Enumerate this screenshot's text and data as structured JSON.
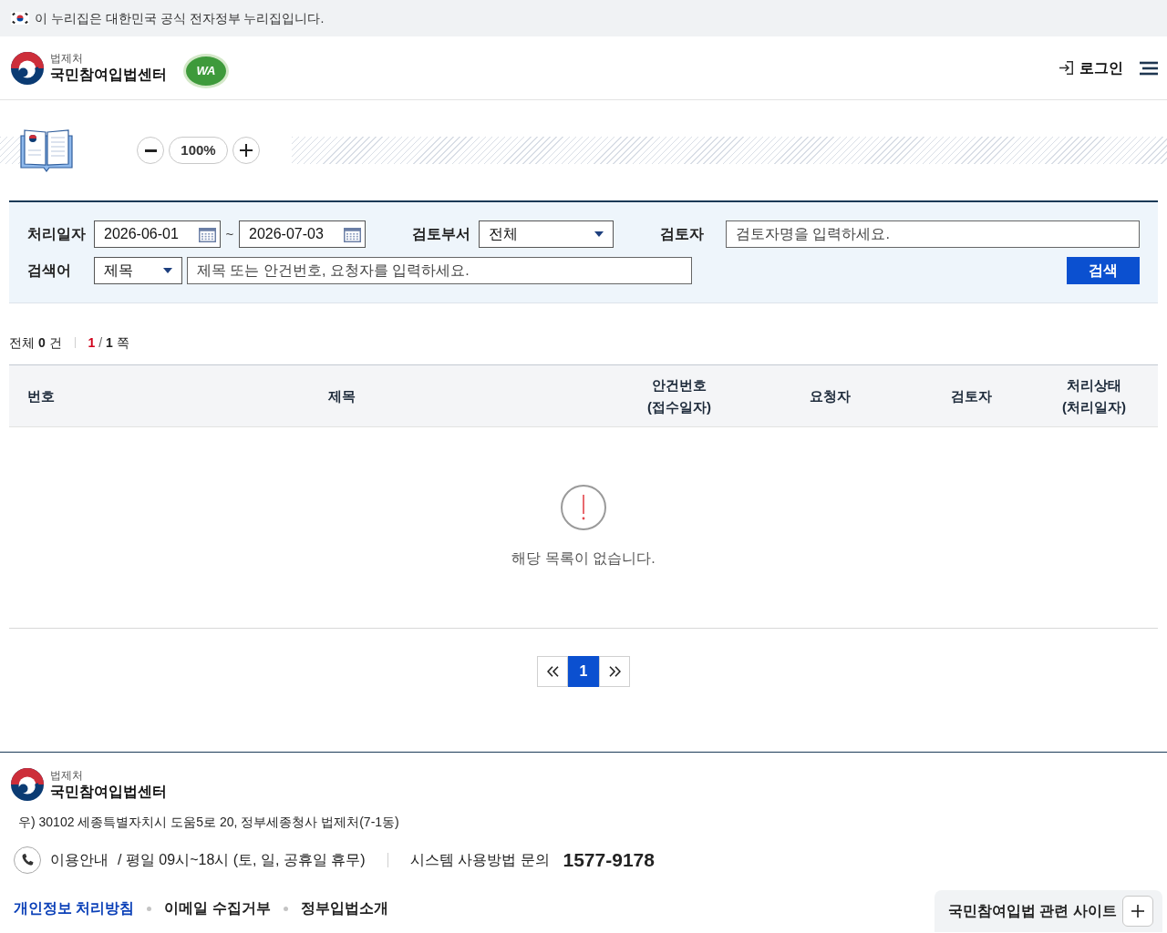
{
  "gov_banner": {
    "text": "이 누리집은 대한민국 공식 전자정부 누리집입니다."
  },
  "header": {
    "agency": "법제처",
    "site_name": "국민참여입법센터",
    "seal_text": "WA",
    "login": "로그인"
  },
  "zoom": {
    "value": "100%"
  },
  "search": {
    "date_range": {
      "label": "처리일자",
      "start": "2026-06-01",
      "separator": "~",
      "end": "2026-07-03"
    },
    "department": {
      "label": "검토부서",
      "value": "전체"
    },
    "reviewer": {
      "label": "검토자",
      "placeholder": "검토자명을 입력하세요."
    },
    "keyword": {
      "label": "검색어",
      "type_value": "제목",
      "placeholder": "제목 또는 안건번호, 요청자를 입력하세요."
    },
    "button": "검색"
  },
  "summary": {
    "total_label": "전체",
    "total": "0",
    "total_unit": "건",
    "current_page": "1",
    "page_separator": "/",
    "page_total": "1",
    "page_unit": "쪽"
  },
  "table": {
    "columns": [
      {
        "label": "번호"
      },
      {
        "label": "제목"
      },
      {
        "label": "안건번호",
        "sublabel": "(접수일자)"
      },
      {
        "label": "요청자"
      },
      {
        "label": "검토자"
      },
      {
        "label": "처리상태",
        "sublabel": "(처리일자)"
      }
    ],
    "empty_message": "해당 목록이 없습니다."
  },
  "pagination": {
    "pages": [
      {
        "label": "1",
        "selected": true
      }
    ]
  },
  "footer": {
    "agency": "법제처",
    "site_name": "국민참여입법센터",
    "address": "우) 30102 세종특별자치시 도움5로 20, 정부세종청사 법제처(7-1동)",
    "hours_label": "이용안내",
    "hours": "/ 평일 09시~18시 (토, 일, 공휴일 휴무)",
    "inquiry_label": "시스템 사용방법 문의",
    "phone": "1577-9178",
    "links": [
      {
        "label": "개인정보 처리방침",
        "highlighted": true
      },
      {
        "label": "이메일 수집거부",
        "highlighted": false
      },
      {
        "label": "정부입법소개",
        "highlighted": false
      }
    ],
    "related_sites": "국민참여입법 관련 사이트"
  }
}
